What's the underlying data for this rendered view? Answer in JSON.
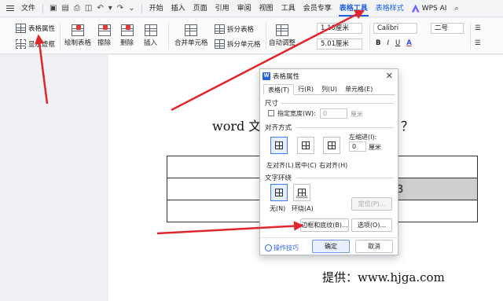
{
  "menubar": {
    "file": "文件",
    "items": [
      "开始",
      "插入",
      "页面",
      "引用",
      "审阅",
      "视图",
      "工具",
      "会员专享"
    ],
    "active_tab": "表格工具",
    "tab_style": "表格样式",
    "wps_ai": "WPS AI"
  },
  "ribbon": {
    "table_props": "表格属性",
    "show_grid": "显示虚框",
    "draw_table": "绘制表格",
    "erase": "擦除",
    "delete": "删除",
    "insert": "插入",
    "merge_cells": "合并单元格",
    "split_table": "拆分表格",
    "split_cells": "拆分单元格",
    "auto_adjust": "自动调整",
    "height_value": "1.10厘米",
    "width_value": "5.01厘米",
    "font_name": "Calibri",
    "font_size": "二号",
    "bold": "B",
    "italic": "I",
    "underline": "U",
    "font_color": "A"
  },
  "document": {
    "title_left": "word 文",
    "title_right": "？",
    "cell_value": "3",
    "credit": "提供：www.hjga.com"
  },
  "dialog": {
    "title": "表格属性",
    "tabs": [
      "表格(T)",
      "行(R)",
      "列(U)",
      "单元格(E)"
    ],
    "size_label": "尺寸",
    "specify_width": "指定宽度(W):",
    "width_value": "0",
    "width_unit": "厘米",
    "align_label": "对齐方式",
    "indent_label": "左缩进(I):",
    "indent_value": "0",
    "indent_unit": "厘米",
    "align_options": [
      "左对齐(L)",
      "居中(C)",
      "右对齐(H)"
    ],
    "wrap_label": "文字环绕",
    "wrap_options": [
      "无(N)",
      "环绕(A)"
    ],
    "position_btn": "定位(P)...",
    "borders_btn": "边框和底纹(B)...",
    "options_btn": "选项(O)...",
    "tips": "操作技巧",
    "ok": "确定",
    "cancel": "取消"
  },
  "colors": {
    "accent": "#1a5ee8",
    "arrow": "#e0262d"
  }
}
